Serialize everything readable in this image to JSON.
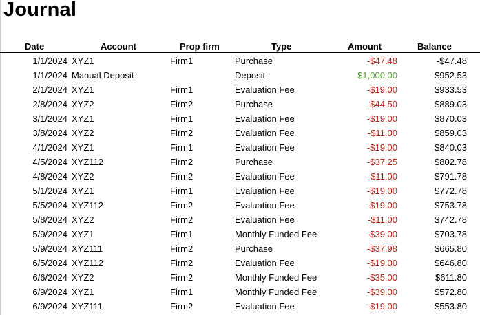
{
  "title": "Journal",
  "colors": {
    "negative": "#b8261b",
    "positive": "#5aa33a"
  },
  "headers": {
    "date": "Date",
    "account": "Account",
    "prop_firm": "Prop firm",
    "type": "Type",
    "amount": "Amount",
    "balance": "Balance"
  },
  "rows": [
    {
      "date": "1/1/2024",
      "account": "XYZ1",
      "prop_firm": "Firm1",
      "type": "Purchase",
      "amount": "-$47.48",
      "sign": "neg",
      "balance": "-$47.48"
    },
    {
      "date": "1/1/2024",
      "account": "Manual Deposit",
      "prop_firm": "",
      "type": "Deposit",
      "amount": "$1,000.00",
      "sign": "pos",
      "balance": "$952.53"
    },
    {
      "date": "2/1/2024",
      "account": "XYZ1",
      "prop_firm": "Firm1",
      "type": "Evaluation Fee",
      "amount": "-$19.00",
      "sign": "neg",
      "balance": "$933.53"
    },
    {
      "date": "2/8/2024",
      "account": "XYZ2",
      "prop_firm": "Firm2",
      "type": "Purchase",
      "amount": "-$44.50",
      "sign": "neg",
      "balance": "$889.03"
    },
    {
      "date": "3/1/2024",
      "account": "XYZ1",
      "prop_firm": "Firm1",
      "type": "Evaluation Fee",
      "amount": "-$19.00",
      "sign": "neg",
      "balance": "$870.03"
    },
    {
      "date": "3/8/2024",
      "account": "XYZ2",
      "prop_firm": "Firm2",
      "type": "Evaluation Fee",
      "amount": "-$11.00",
      "sign": "neg",
      "balance": "$859.03"
    },
    {
      "date": "4/1/2024",
      "account": "XYZ1",
      "prop_firm": "Firm1",
      "type": "Evaluation Fee",
      "amount": "-$19.00",
      "sign": "neg",
      "balance": "$840.03"
    },
    {
      "date": "4/5/2024",
      "account": "XYZ112",
      "prop_firm": "Firm2",
      "type": "Purchase",
      "amount": "-$37.25",
      "sign": "neg",
      "balance": "$802.78"
    },
    {
      "date": "4/8/2024",
      "account": "XYZ2",
      "prop_firm": "Firm2",
      "type": "Evaluation Fee",
      "amount": "-$11.00",
      "sign": "neg",
      "balance": "$791.78"
    },
    {
      "date": "5/1/2024",
      "account": "XYZ1",
      "prop_firm": "Firm1",
      "type": "Evaluation Fee",
      "amount": "-$19.00",
      "sign": "neg",
      "balance": "$772.78"
    },
    {
      "date": "5/5/2024",
      "account": "XYZ112",
      "prop_firm": "Firm2",
      "type": "Evaluation Fee",
      "amount": "-$19.00",
      "sign": "neg",
      "balance": "$753.78"
    },
    {
      "date": "5/8/2024",
      "account": "XYZ2",
      "prop_firm": "Firm2",
      "type": "Evaluation Fee",
      "amount": "-$11.00",
      "sign": "neg",
      "balance": "$742.78"
    },
    {
      "date": "5/9/2024",
      "account": "XYZ1",
      "prop_firm": "Firm1",
      "type": "Monthly Funded Fee",
      "amount": "-$39.00",
      "sign": "neg",
      "balance": "$703.78"
    },
    {
      "date": "5/9/2024",
      "account": "XYZ111",
      "prop_firm": "Firm2",
      "type": "Purchase",
      "amount": "-$37.98",
      "sign": "neg",
      "balance": "$665.80"
    },
    {
      "date": "6/5/2024",
      "account": "XYZ112",
      "prop_firm": "Firm2",
      "type": "Evaluation Fee",
      "amount": "-$19.00",
      "sign": "neg",
      "balance": "$646.80"
    },
    {
      "date": "6/6/2024",
      "account": "XYZ2",
      "prop_firm": "Firm2",
      "type": "Monthly Funded Fee",
      "amount": "-$35.00",
      "sign": "neg",
      "balance": "$611.80"
    },
    {
      "date": "6/9/2024",
      "account": "XYZ1",
      "prop_firm": "Firm1",
      "type": "Monthly Funded Fee",
      "amount": "-$39.00",
      "sign": "neg",
      "balance": "$572.80"
    },
    {
      "date": "6/9/2024",
      "account": "XYZ111",
      "prop_firm": "Firm2",
      "type": "Evaluation Fee",
      "amount": "-$19.00",
      "sign": "neg",
      "balance": "$553.80"
    }
  ]
}
